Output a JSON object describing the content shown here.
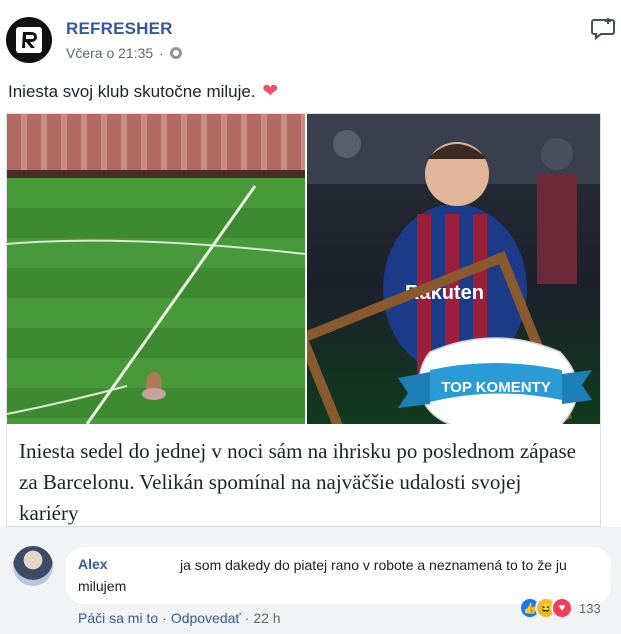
{
  "post": {
    "page_name": "REFRESHER",
    "timestamp": "Včera o 21:35",
    "separator": "·",
    "text": "Iniesta svoj klub skutočne miluje.",
    "heart_emoji": "❤"
  },
  "link_card": {
    "title": "Iniesta sedel do jednej v noci sám na ihrisku po poslednom zápase za Barcelonu. Velikán spomínal na najväčšie udalosti svojej kariéry",
    "image": {
      "badge_text": "TOP KOMENTY",
      "jersey_text": "Rakuten"
    }
  },
  "comment": {
    "author": "Alex",
    "text": "ja som dakedy do piatej rano v robote a neznamená to to že ju milujem",
    "actions": {
      "like": "Páči sa mi to",
      "reply": "Odpovedať",
      "time": "22 h",
      "dot": "·"
    },
    "reactions": {
      "count": "133",
      "types": [
        "like-icon",
        "haha-icon",
        "love-icon"
      ]
    }
  },
  "colors": {
    "link": "#365899",
    "text": "#1d2129",
    "secondary": "#616770",
    "badge": "#2a9bd4"
  }
}
